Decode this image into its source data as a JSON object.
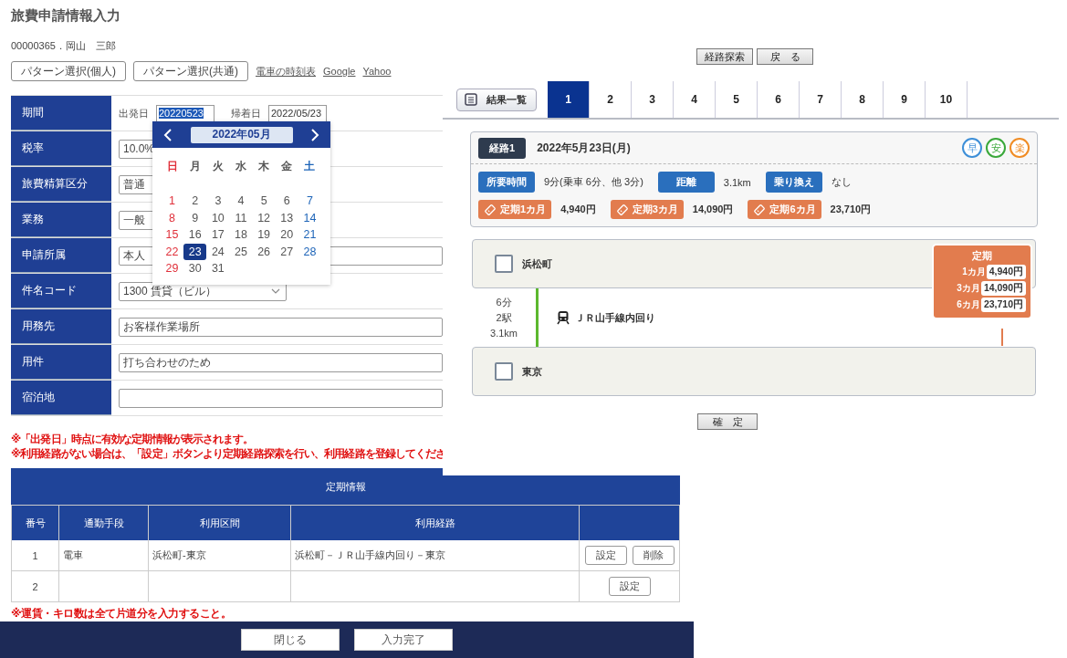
{
  "page_title": "旅費申請情報入力",
  "user": "00000365．岡山　三郎",
  "pattern_buttons": [
    "パターン選択(個人)",
    "パターン選択(共通)"
  ],
  "links": [
    "電車の時刻表",
    "Google",
    "Yahoo"
  ],
  "form": {
    "rows": [
      {
        "label": "期間",
        "kind": "dates",
        "from_label": "出発日",
        "from_value": "20220523",
        "to_label": "帰着日",
        "to_value": "2022/05/23"
      },
      {
        "label": "税率",
        "kind": "field",
        "value": "10.0%"
      },
      {
        "label": "旅費精算区分",
        "kind": "field",
        "value": "普通"
      },
      {
        "label": "業務",
        "kind": "field",
        "value": "一般"
      },
      {
        "label": "申請所属",
        "kind": "wide",
        "value": "本人"
      },
      {
        "label": "件名コード",
        "kind": "select",
        "value": "1300 賃貸（ビル）"
      },
      {
        "label": "用務先",
        "kind": "wide",
        "value": "お客様作業場所"
      },
      {
        "label": "用件",
        "kind": "wide",
        "value": "打ち合わせのため"
      },
      {
        "label": "宿泊地",
        "kind": "wide"
      }
    ]
  },
  "calendar": {
    "month": "2022年05月",
    "weekdays": [
      "日",
      "月",
      "火",
      "水",
      "木",
      "金",
      "土"
    ],
    "days": [
      {
        "label": "1",
        "selected": false
      },
      {
        "label": "2",
        "selected": false
      },
      {
        "label": "3",
        "selected": false
      },
      {
        "label": "4",
        "selected": false
      },
      {
        "label": "5",
        "selected": false
      },
      {
        "label": "6",
        "selected": false
      },
      {
        "label": "7",
        "selected": false
      },
      {
        "label": "8",
        "selected": false
      },
      {
        "label": "9",
        "selected": false
      },
      {
        "label": "10",
        "selected": false
      },
      {
        "label": "11",
        "selected": false
      },
      {
        "label": "12",
        "selected": false
      },
      {
        "label": "13",
        "selected": false
      },
      {
        "label": "14",
        "selected": false
      },
      {
        "label": "15",
        "selected": false
      },
      {
        "label": "16",
        "selected": false
      },
      {
        "label": "17",
        "selected": false
      },
      {
        "label": "18",
        "selected": false
      },
      {
        "label": "19",
        "selected": false
      },
      {
        "label": "20",
        "selected": false
      },
      {
        "label": "21",
        "selected": false
      },
      {
        "label": "22",
        "selected": false
      },
      {
        "label": "23",
        "selected": true
      },
      {
        "label": "24",
        "selected": false
      },
      {
        "label": "25",
        "selected": false
      },
      {
        "label": "26",
        "selected": false
      },
      {
        "label": "27",
        "selected": false
      },
      {
        "label": "28",
        "selected": false
      },
      {
        "label": "29",
        "selected": false
      },
      {
        "label": "30",
        "selected": false
      },
      {
        "label": "31",
        "selected": false
      }
    ]
  },
  "notes": [
    "※「出発日」時点に有効な定期情報が表示されます。",
    "※利用経路がない場合は、「設定」ボタンより定期経路探索を行い、利用経路を登録してくださ"
  ],
  "commute_table": {
    "title": "定期情報",
    "columns": [
      "番号",
      "通勤手段",
      "利用区間",
      "利用経路"
    ],
    "rows": [
      {
        "cells": [
          "1",
          "電車",
          "浜松町-東京",
          "浜松町－ＪＲ山手線内回り－東京"
        ],
        "buttons": [
          "設定",
          "削除"
        ]
      },
      {
        "cells": [
          "2"
        ],
        "buttons": [
          "設定"
        ]
      }
    ]
  },
  "bottom_note": "※運賃・キロ数は全て片道分を入力すること。",
  "footer_buttons": [
    "閉じる",
    "入力完了"
  ],
  "route_panel": {
    "top_buttons": [
      "経路探索",
      "戻　る"
    ],
    "results_button": "結果一覧",
    "tabs": [
      {
        "label": "1",
        "selected": true
      },
      {
        "label": "2",
        "selected": false
      },
      {
        "label": "3",
        "selected": false
      },
      {
        "label": "4",
        "selected": false
      },
      {
        "label": "5",
        "selected": false
      },
      {
        "label": "6",
        "selected": false
      },
      {
        "label": "7",
        "selected": false
      },
      {
        "label": "8",
        "selected": false
      },
      {
        "label": "9",
        "selected": false
      },
      {
        "label": "10",
        "selected": false
      }
    ],
    "route": {
      "badge": "経路1",
      "date": "2022年5月23日(月)",
      "tags": [
        {
          "label": "早",
          "color": "#3d8fd8"
        },
        {
          "label": "安",
          "color": "#3aa83a"
        },
        {
          "label": "楽",
          "color": "#f08c24"
        }
      ],
      "stats": [
        {
          "label": "所要時間",
          "value": "9分(乗車 6分、他 3分)"
        },
        {
          "label": "距離",
          "value": "3.1km"
        },
        {
          "label": "乗り換え",
          "value": "なし"
        }
      ],
      "fares": [
        {
          "label": "定期1カ月",
          "value": "4,940円"
        },
        {
          "label": "定期3カ月",
          "value": "14,090円"
        },
        {
          "label": "定期6カ月",
          "value": "23,710円"
        }
      ]
    },
    "stations": [
      {
        "name": "浜松町",
        "checked": false
      },
      {
        "name": "東京",
        "checked": false
      }
    ],
    "segment": {
      "time": "6分",
      "stops": "2駅",
      "distance": "3.1km",
      "line": "ＪＲ山手線内回り"
    },
    "fare_box": {
      "title": "定期",
      "rows": [
        {
          "label": "1カ月",
          "value": "4,940円"
        },
        {
          "label": "3カ月",
          "value": "14,090円"
        },
        {
          "label": "6カ月",
          "value": "23,710円"
        }
      ]
    },
    "confirm": "確　定"
  }
}
